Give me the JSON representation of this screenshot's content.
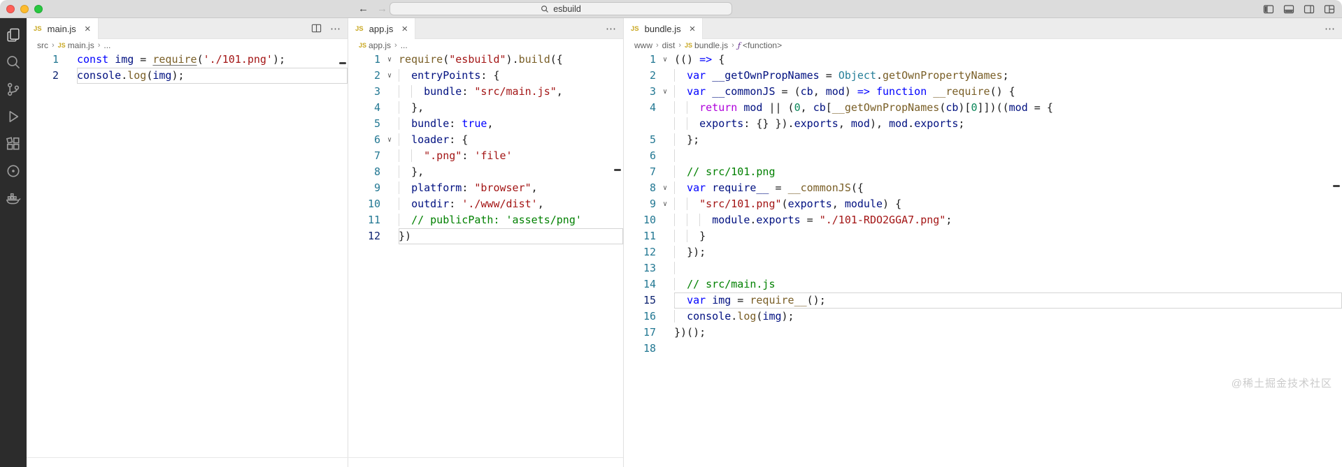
{
  "titlebar": {
    "command_center": {
      "value": "esbuild"
    }
  },
  "icons": {
    "close": "×",
    "more": "⋯",
    "chevron": "∨",
    "separator": "›",
    "js_badge": "JS",
    "fn_symbol": "ƒ",
    "back": "←",
    "forward": "→"
  },
  "watermark": {
    "text": "@稀土掘金技术社区"
  },
  "panes": [
    {
      "tab": {
        "label": "main.js"
      },
      "breadcrumbs": [
        {
          "label": "src"
        },
        {
          "label": "main.js",
          "icon": "js"
        },
        {
          "label": "..."
        }
      ],
      "active_line": 2,
      "folds": [],
      "lines": [
        {
          "n": 1,
          "i": 0,
          "t": [
            [
              "const ",
              "kw"
            ],
            [
              "img",
              "vr"
            ],
            [
              " = ",
              "pun"
            ],
            [
              "require",
              "fnu"
            ],
            [
              "(",
              "pun"
            ],
            [
              "'./101.png'",
              "str"
            ],
            [
              ");",
              "pun"
            ]
          ]
        },
        {
          "n": 2,
          "i": 0,
          "t": [
            [
              "console",
              "vr"
            ],
            [
              ".",
              "pun"
            ],
            [
              "log",
              "fn"
            ],
            [
              "(",
              "pun"
            ],
            [
              "img",
              "vr"
            ],
            [
              ");",
              "pun"
            ]
          ]
        }
      ]
    },
    {
      "tab": {
        "label": "app.js"
      },
      "breadcrumbs": [
        {
          "label": "app.js",
          "icon": "js"
        },
        {
          "label": "..."
        }
      ],
      "active_line": 12,
      "folds": [
        1,
        2,
        6
      ],
      "lines": [
        {
          "n": 1,
          "i": 0,
          "t": [
            [
              "require",
              "fn"
            ],
            [
              "(",
              "pun"
            ],
            [
              "\"esbuild\"",
              "str"
            ],
            [
              ")",
              "pun"
            ],
            [
              ".",
              "pun"
            ],
            [
              "build",
              "fn"
            ],
            [
              "({",
              "pun"
            ]
          ]
        },
        {
          "n": 2,
          "i": 2,
          "t": [
            [
              "entryPoints",
              "vr"
            ],
            [
              ": {",
              "pun"
            ]
          ]
        },
        {
          "n": 3,
          "i": 4,
          "t": [
            [
              "bundle",
              "vr"
            ],
            [
              ": ",
              "pun"
            ],
            [
              "\"src/main.js\"",
              "str"
            ],
            [
              ",",
              "pun"
            ]
          ]
        },
        {
          "n": 4,
          "i": 2,
          "t": [
            [
              "},",
              "pun"
            ]
          ]
        },
        {
          "n": 5,
          "i": 2,
          "t": [
            [
              "bundle",
              "vr"
            ],
            [
              ": ",
              "pun"
            ],
            [
              "true",
              "kw"
            ],
            [
              ",",
              "pun"
            ]
          ]
        },
        {
          "n": 6,
          "i": 2,
          "t": [
            [
              "loader",
              "vr"
            ],
            [
              ": {",
              "pun"
            ]
          ]
        },
        {
          "n": 7,
          "i": 4,
          "t": [
            [
              "\".png\"",
              "str"
            ],
            [
              ": ",
              "pun"
            ],
            [
              "'file'",
              "str"
            ]
          ]
        },
        {
          "n": 8,
          "i": 2,
          "t": [
            [
              "},",
              "pun"
            ]
          ]
        },
        {
          "n": 9,
          "i": 2,
          "t": [
            [
              "platform",
              "vr"
            ],
            [
              ": ",
              "pun"
            ],
            [
              "\"browser\"",
              "str"
            ],
            [
              ",",
              "pun"
            ]
          ]
        },
        {
          "n": 10,
          "i": 2,
          "t": [
            [
              "outdir",
              "vr"
            ],
            [
              ": ",
              "pun"
            ],
            [
              "'./www/dist'",
              "str"
            ],
            [
              ",",
              "pun"
            ]
          ]
        },
        {
          "n": 11,
          "i": 2,
          "t": [
            [
              "// publicPath: 'assets/png'",
              "com"
            ]
          ]
        },
        {
          "n": 12,
          "i": 0,
          "t": [
            [
              "})",
              "pun"
            ]
          ]
        }
      ]
    },
    {
      "tab": {
        "label": "bundle.js"
      },
      "breadcrumbs": [
        {
          "label": "www"
        },
        {
          "label": "dist"
        },
        {
          "label": "bundle.js",
          "icon": "js"
        },
        {
          "label": "<function>",
          "icon": "fn"
        }
      ],
      "active_line": 15,
      "folds": [
        1,
        3,
        8,
        9
      ],
      "lines": [
        {
          "n": 1,
          "i": 0,
          "t": [
            [
              "(() ",
              "pun"
            ],
            [
              "=>",
              "kw"
            ],
            [
              " {",
              "pun"
            ]
          ]
        },
        {
          "n": 2,
          "i": 2,
          "t": [
            [
              "var ",
              "kw"
            ],
            [
              "__getOwnPropNames",
              "vr"
            ],
            [
              " = ",
              "pun"
            ],
            [
              "Object",
              "cls"
            ],
            [
              ".",
              "pun"
            ],
            [
              "getOwnPropertyNames",
              "fn"
            ],
            [
              ";",
              "pun"
            ]
          ]
        },
        {
          "n": 3,
          "i": 2,
          "t": [
            [
              "var ",
              "kw"
            ],
            [
              "__commonJS",
              "vr"
            ],
            [
              " = (",
              "pun"
            ],
            [
              "cb",
              "vr"
            ],
            [
              ", ",
              "pun"
            ],
            [
              "mod",
              "vr"
            ],
            [
              ") ",
              "pun"
            ],
            [
              "=>",
              "kw"
            ],
            [
              " ",
              "pun"
            ],
            [
              "function",
              "kw"
            ],
            [
              " ",
              "pun"
            ],
            [
              "__require",
              "fn"
            ],
            [
              "() {",
              "pun"
            ]
          ]
        },
        {
          "n": 4,
          "i": 4,
          "t": [
            [
              "return",
              "ctl"
            ],
            [
              " ",
              "pun"
            ],
            [
              "mod",
              "vr"
            ],
            [
              " || (",
              "pun"
            ],
            [
              "0",
              "num"
            ],
            [
              ", ",
              "pun"
            ],
            [
              "cb",
              "vr"
            ],
            [
              "[",
              "pun"
            ],
            [
              "__getOwnPropNames",
              "fn"
            ],
            [
              "(",
              "pun"
            ],
            [
              "cb",
              "vr"
            ],
            [
              ")[",
              "pun"
            ],
            [
              "0",
              "num"
            ],
            [
              "]])((",
              "pun"
            ],
            [
              "mod",
              "vr"
            ],
            [
              " = {",
              "pun"
            ]
          ]
        },
        {
          "n": 0,
          "i": 4,
          "t": [
            [
              "exports",
              "vr"
            ],
            [
              ": {} }).",
              "pun"
            ],
            [
              "exports",
              "vr"
            ],
            [
              ", ",
              "pun"
            ],
            [
              "mod",
              "vr"
            ],
            [
              "), ",
              "pun"
            ],
            [
              "mod",
              "vr"
            ],
            [
              ".",
              "pun"
            ],
            [
              "exports",
              "vr"
            ],
            [
              ";",
              "pun"
            ]
          ]
        },
        {
          "n": 5,
          "i": 2,
          "t": [
            [
              "};",
              "pun"
            ]
          ]
        },
        {
          "n": 6,
          "i": 2,
          "t": []
        },
        {
          "n": 7,
          "i": 2,
          "t": [
            [
              "// src/101.png",
              "com"
            ]
          ]
        },
        {
          "n": 8,
          "i": 2,
          "t": [
            [
              "var ",
              "kw"
            ],
            [
              "require__",
              "vr"
            ],
            [
              " = ",
              "pun"
            ],
            [
              "__commonJS",
              "fn"
            ],
            [
              "({",
              "pun"
            ]
          ]
        },
        {
          "n": 9,
          "i": 4,
          "t": [
            [
              "\"src/101.png\"",
              "str"
            ],
            [
              "(",
              "pun"
            ],
            [
              "exports",
              "vr"
            ],
            [
              ", ",
              "pun"
            ],
            [
              "module",
              "vr"
            ],
            [
              ") {",
              "pun"
            ]
          ]
        },
        {
          "n": 10,
          "i": 6,
          "t": [
            [
              "module",
              "vr"
            ],
            [
              ".",
              "pun"
            ],
            [
              "exports",
              "vr"
            ],
            [
              " = ",
              "pun"
            ],
            [
              "\"./101-RDO2GGA7.png\"",
              "str"
            ],
            [
              ";",
              "pun"
            ]
          ]
        },
        {
          "n": 11,
          "i": 4,
          "t": [
            [
              "}",
              "pun"
            ]
          ]
        },
        {
          "n": 12,
          "i": 2,
          "t": [
            [
              "});",
              "pun"
            ]
          ]
        },
        {
          "n": 13,
          "i": 2,
          "t": []
        },
        {
          "n": 14,
          "i": 2,
          "t": [
            [
              "// src/main.js",
              "com"
            ]
          ]
        },
        {
          "n": 15,
          "i": 2,
          "t": [
            [
              "var ",
              "kw"
            ],
            [
              "img",
              "vr"
            ],
            [
              " = ",
              "pun"
            ],
            [
              "require__",
              "fn"
            ],
            [
              "();",
              "pun"
            ]
          ]
        },
        {
          "n": 16,
          "i": 2,
          "t": [
            [
              "console",
              "vr"
            ],
            [
              ".",
              "pun"
            ],
            [
              "log",
              "fn"
            ],
            [
              "(",
              "pun"
            ],
            [
              "img",
              "vr"
            ],
            [
              ");",
              "pun"
            ]
          ]
        },
        {
          "n": 17,
          "i": 0,
          "t": [
            [
              "})();",
              "pun"
            ]
          ]
        },
        {
          "n": 18,
          "i": 0,
          "t": []
        }
      ]
    }
  ]
}
